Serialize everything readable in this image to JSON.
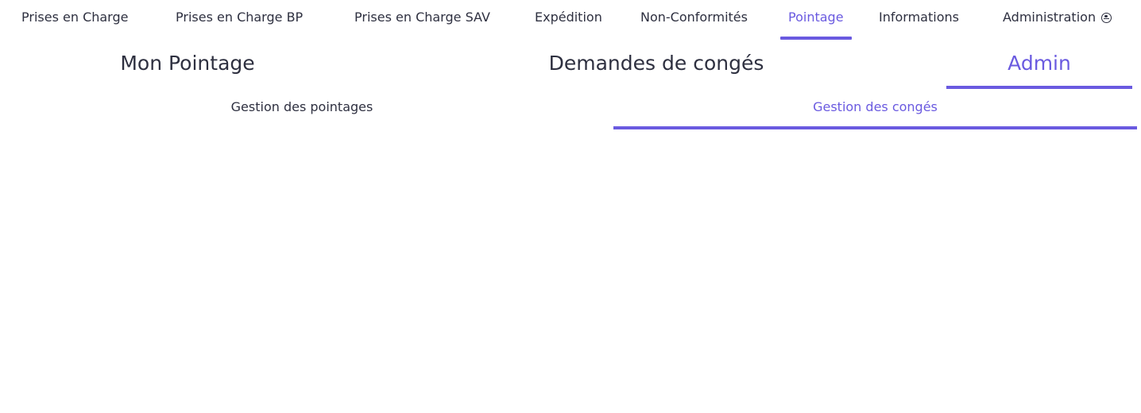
{
  "top_nav": {
    "tabs": [
      {
        "label": "Prises en Charge"
      },
      {
        "label": "Prises en Charge BP"
      },
      {
        "label": "Prises en Charge SAV"
      },
      {
        "label": "Expédition"
      },
      {
        "label": "Non-Conformités"
      },
      {
        "label": "Pointage",
        "active": true
      },
      {
        "label": "Informations"
      },
      {
        "label": "Administration",
        "icon": "admin-user-icon"
      }
    ],
    "accent_color": "#6a5ae0"
  },
  "sub_nav": {
    "tabs": [
      {
        "label": "Mon Pointage"
      },
      {
        "label": "Demandes de congés"
      },
      {
        "label": "Admin",
        "active": true
      }
    ]
  },
  "third_nav": {
    "tabs": [
      {
        "label": "Gestion des pointages"
      },
      {
        "label": "Gestion des congés",
        "active": true
      }
    ]
  }
}
